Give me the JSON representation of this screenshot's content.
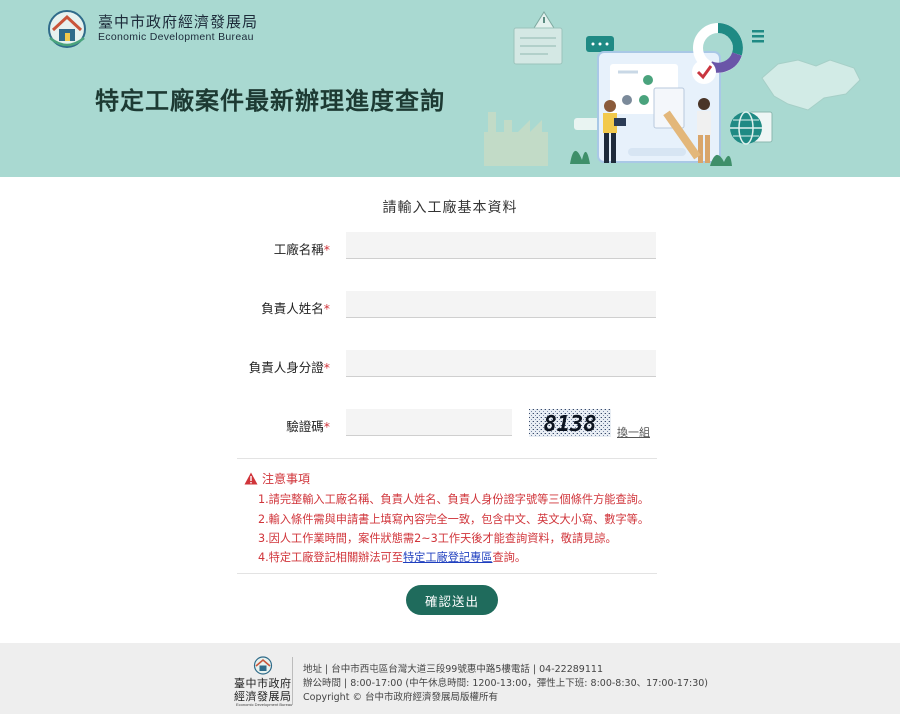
{
  "header": {
    "org_name_cn": "臺中市政府經濟發展局",
    "org_name_en": "Economic Development Bureau",
    "page_title": "特定工廠案件最新辦理進度查詢"
  },
  "form": {
    "heading": "請輸入工廠基本資料",
    "required_mark": "*",
    "fields": [
      {
        "label": "工廠名稱",
        "value": "",
        "placeholder": ""
      },
      {
        "label": "負責人姓名",
        "value": "",
        "placeholder": ""
      },
      {
        "label": "負責人身分證",
        "value": "",
        "placeholder": ""
      },
      {
        "label": "驗證碼",
        "value": "",
        "placeholder": ""
      }
    ],
    "captcha_text": "8138",
    "refresh_label": "換一組",
    "submit_label": "確認送出"
  },
  "notice": {
    "title": "注意事項",
    "items": [
      "1.請完整輸入工廠名稱、負責人姓名、負責人身份證字號等三個條件方能查詢。",
      "2.輸入條件需與申請書上填寫內容完全一致，包含中文、英文大小寫、數字等。",
      "3.因人工作業時間，案件狀態需2~3工作天後才能查詢資料，敬請見諒。"
    ],
    "item4_prefix": "4.特定工廠登記相關辦法可至",
    "item4_link": "特定工廠登記專區",
    "item4_suffix": "查詢。"
  },
  "footer": {
    "name_line1": "臺中市政府",
    "name_line2": "經濟發展局",
    "name_en": "Economic Development Bureau",
    "address": "地址 | 台中市西屯區台灣大道三段99號惠中路5樓電話 | 04-22289111",
    "hours": "辦公時間 | 8:00-17:00 (中午休息時間: 1200-13:00，彈性上下班: 8:00-8:30、17:00-17:30)",
    "copyright": "Copyright © 台中市政府經濟發展局版權所有"
  },
  "colors": {
    "banner_bg": "#a9d9d1",
    "accent_green": "#1f6b5c",
    "required_red": "#d0343a",
    "link_blue": "#1f3fbf",
    "footer_bg": "#eeeeee"
  }
}
